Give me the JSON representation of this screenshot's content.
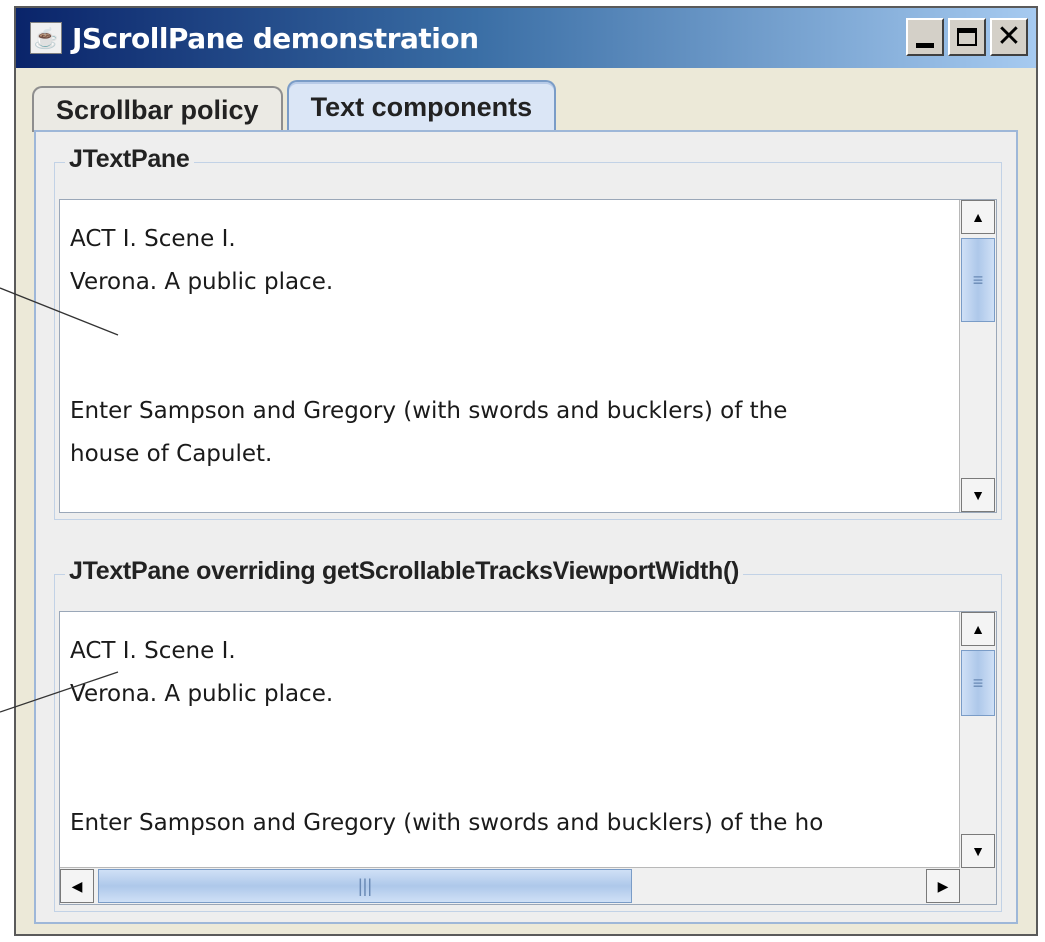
{
  "window": {
    "title": "JScrollPane demonstration",
    "icon": "java-cup-icon",
    "controls": {
      "minimize_icon": "minimize-icon",
      "maximize_icon": "maximize-icon",
      "close_icon": "close-icon"
    }
  },
  "tabs": [
    {
      "label": "Scrollbar policy",
      "selected": false
    },
    {
      "label": "Text components",
      "selected": true
    }
  ],
  "panes": [
    {
      "title": "JTextPane",
      "lines": [
        "ACT I. Scene I.",
        "Verona. A public place.",
        "",
        "",
        "Enter Sampson and Gregory (with swords and bucklers) of the",
        "house of Capulet."
      ],
      "vertical_scroll_fraction": 0.0,
      "has_horizontal_scrollbar": false
    },
    {
      "title": "JTextPane overriding getScrollableTracksViewportWidth()",
      "lines": [
        "ACT I. Scene I.",
        "Verona. A public place.",
        "",
        "",
        "Enter Sampson and Gregory (with swords and bucklers) of the ho"
      ],
      "vertical_scroll_fraction": 0.0,
      "has_horizontal_scrollbar": true
    }
  ],
  "scroll_icons": {
    "up": "arrow-up-icon",
    "down": "arrow-down-icon",
    "left": "arrow-left-icon",
    "right": "arrow-right-icon",
    "grip": "thumb-grip-icon"
  },
  "colors": {
    "title_gradient_start": "#0a246a",
    "title_gradient_end": "#a6caf0",
    "selected_tab": "#dbe6f6",
    "scroll_thumb": "#aec8ea"
  }
}
